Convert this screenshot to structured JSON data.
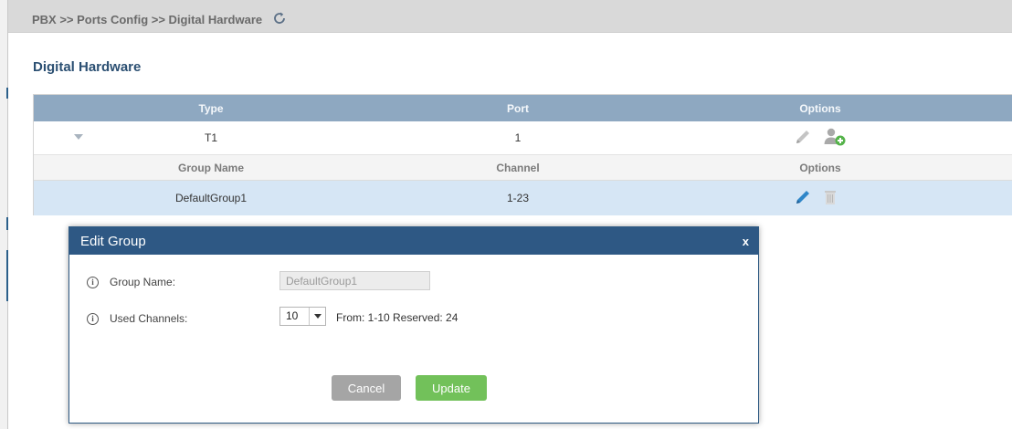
{
  "breadcrumb": {
    "text": "PBX >> Ports Config >> Digital Hardware"
  },
  "page": {
    "title": "Digital Hardware"
  },
  "grid": {
    "header": {
      "type": "Type",
      "port": "Port",
      "options": "Options"
    },
    "port_row": {
      "type": "T1",
      "port": "1"
    },
    "group_header": {
      "group_name": "Group Name",
      "channel": "Channel",
      "options": "Options"
    },
    "group_row": {
      "group_name": "DefaultGroup1",
      "channel": "1-23"
    }
  },
  "modal": {
    "title": "Edit Group",
    "close": "x",
    "group_name_label": "Group Name:",
    "group_name_value": "DefaultGroup1",
    "used_channels_label": "Used Channels:",
    "used_channels_value": "10",
    "range_text": "From: 1-10 Reserved: 24",
    "info_glyph": "i",
    "cancel_label": "Cancel",
    "update_label": "Update"
  },
  "colors": {
    "header_bg": "#8ea8c1",
    "modal_header": "#2e5884",
    "update_button": "#72c15a",
    "cancel_button": "#a5a5a5",
    "selected_row": "#d6e6f5"
  }
}
